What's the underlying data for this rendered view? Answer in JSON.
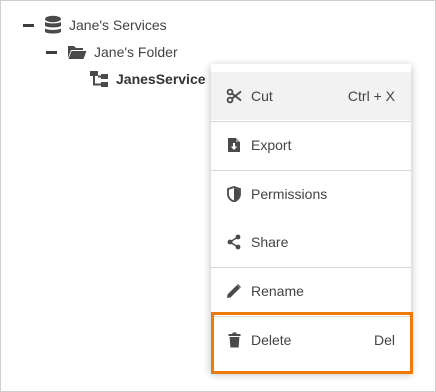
{
  "tree": {
    "root": {
      "label": "Jane's Services",
      "icon": "database-icon"
    },
    "folder": {
      "label": "Jane's Folder",
      "icon": "folder-open-icon"
    },
    "service": {
      "label": "JanesService",
      "icon": "service-tree-icon"
    }
  },
  "context_menu": {
    "items": [
      {
        "label": "Cut",
        "shortcut": "Ctrl + X",
        "icon": "scissors-icon",
        "state": "hovered"
      },
      {
        "label": "Export",
        "shortcut": "",
        "icon": "file-export-icon"
      },
      {
        "label": "Permissions",
        "shortcut": "",
        "icon": "shield-icon"
      },
      {
        "label": "Share",
        "shortcut": "",
        "icon": "share-icon"
      },
      {
        "label": "Rename",
        "shortcut": "",
        "icon": "pencil-icon"
      },
      {
        "label": "Delete",
        "shortcut": "Del",
        "icon": "trash-icon",
        "state": "highlighted"
      }
    ]
  },
  "colors": {
    "highlight_border": "#ee7a0c",
    "hover_background": "#f2f2f2",
    "icon_color": "#4a4a4a"
  }
}
